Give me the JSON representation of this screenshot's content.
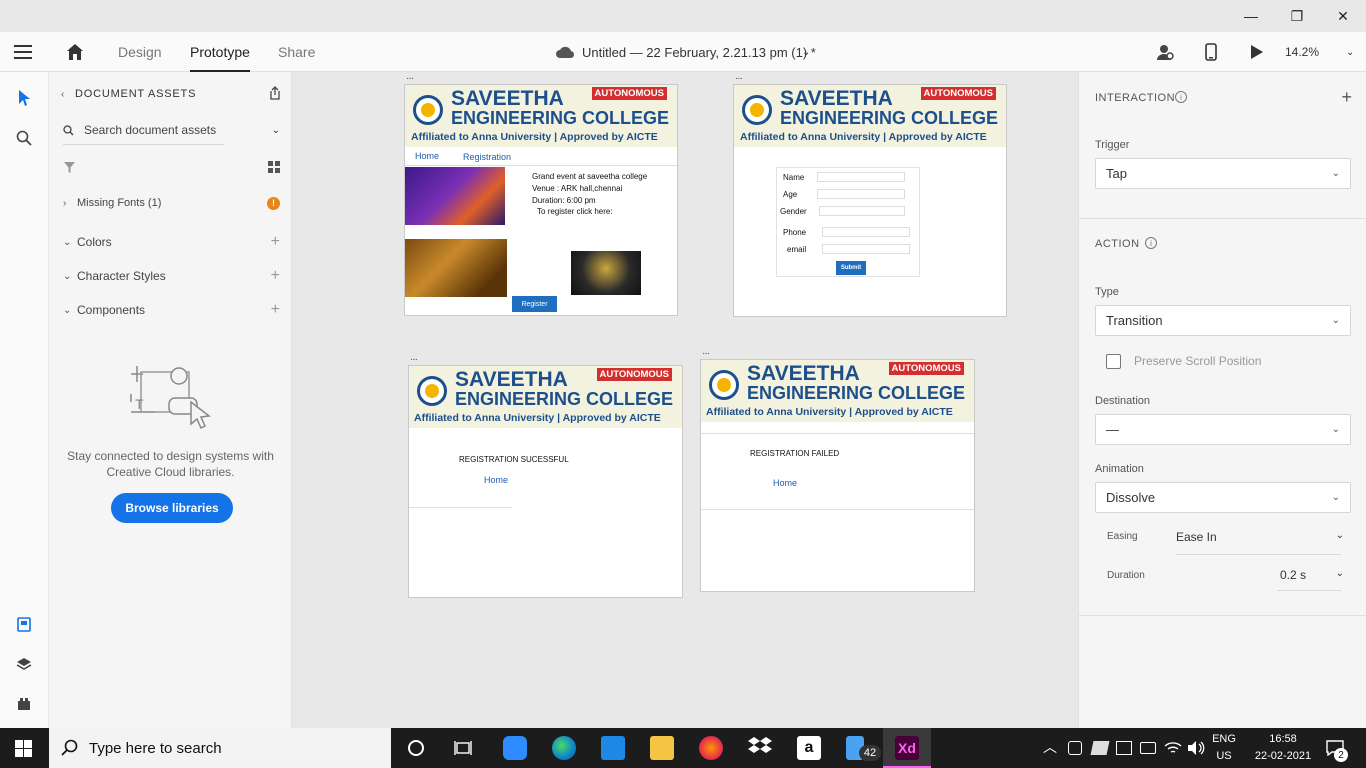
{
  "window": {
    "minimize": "—",
    "maximize": "❐",
    "close": "✕"
  },
  "appbar": {
    "tabs": [
      {
        "label": "Design"
      },
      {
        "label": "Prototype"
      },
      {
        "label": "Share"
      }
    ],
    "doc_title": "Untitled — 22 February, 2.21.13 pm (1) *",
    "zoom": "14.2%"
  },
  "assets": {
    "header": "DOCUMENT ASSETS",
    "search_placeholder": "Search document assets",
    "missing_fonts": "Missing Fonts (1)",
    "sections": [
      {
        "label": "Colors"
      },
      {
        "label": "Character Styles"
      },
      {
        "label": "Components"
      }
    ],
    "empty_text_1": "Stay connected to design systems with",
    "empty_text_2": "Creative Cloud libraries.",
    "browse_button": "Browse libraries"
  },
  "college": {
    "name_line1": "SAVEETHA",
    "name_line2": "ENGINEERING COLLEGE",
    "affiliation": "Affiliated to Anna University | Approved by AICTE",
    "badge": "AUTONOMOUS"
  },
  "artboard_home": {
    "nav_home": "Home",
    "nav_registration": "Registration",
    "event_line1": "Grand event at saveetha college",
    "event_line2": "Venue : ARK hall,chennai",
    "event_line3": "Duration: 6:00 pm",
    "event_line4": "To register click here:",
    "register_button": "Register"
  },
  "artboard_form": {
    "fields": [
      {
        "label": "Name"
      },
      {
        "label": "Age"
      },
      {
        "label": "Gender"
      },
      {
        "label": "Phone"
      },
      {
        "label": "email"
      }
    ],
    "submit": "Submit"
  },
  "artboard_success": {
    "message": "REGISTRATION SUCESSFUL",
    "home_link": "Home"
  },
  "artboard_failed": {
    "message": "REGISTRATION FAILED",
    "home_link": "Home"
  },
  "props": {
    "interaction_title": "INTERACTION",
    "trigger_label": "Trigger",
    "trigger_value": "Tap",
    "action_title": "ACTION",
    "type_label": "Type",
    "type_value": "Transition",
    "preserve_scroll": "Preserve Scroll Position",
    "destination_label": "Destination",
    "destination_value": "—",
    "animation_label": "Animation",
    "animation_value": "Dissolve",
    "easing_label": "Easing",
    "easing_value": "Ease In",
    "duration_label": "Duration",
    "duration_value": "0.2 s"
  },
  "taskbar": {
    "search_placeholder": "Type here to search",
    "badge_count": "42",
    "lang_1": "ENG",
    "lang_2": "US",
    "time": "16:58",
    "date": "22-02-2021",
    "notification_count": "2"
  },
  "colors": {
    "accent": "#1473e6",
    "college_blue": "#1d4f8c",
    "badge_red": "#d32f2f",
    "banner_bg": "#f3f2de"
  }
}
